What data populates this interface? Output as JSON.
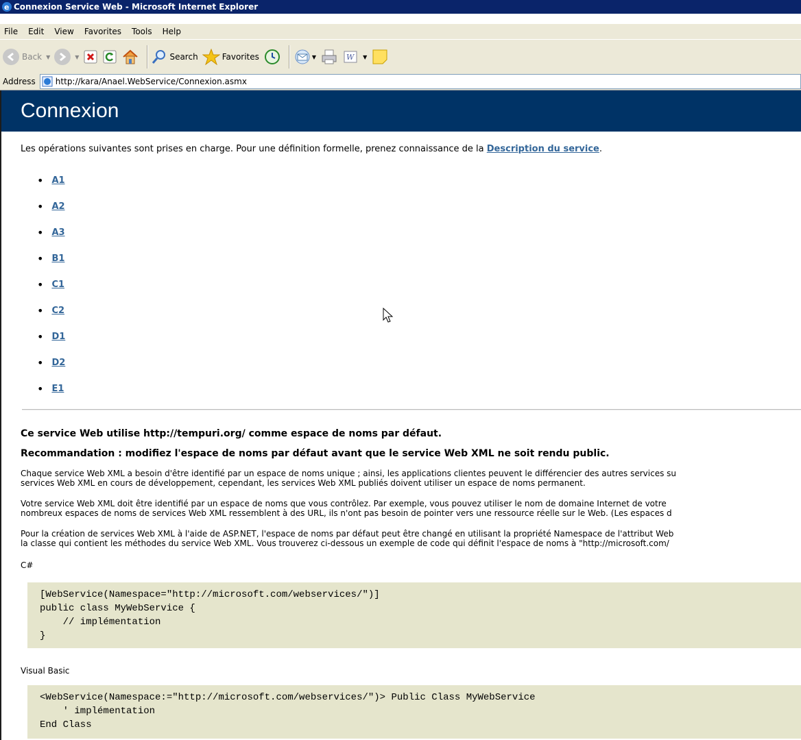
{
  "window": {
    "title": "Connexion Service Web - Microsoft Internet Explorer"
  },
  "menu": [
    "File",
    "Edit",
    "View",
    "Favorites",
    "Tools",
    "Help"
  ],
  "toolbar": {
    "back_label": "Back",
    "search_label": "Search",
    "favorites_label": "Favorites"
  },
  "address": {
    "label": "Address",
    "url": "http://kara/Anael.WebService/Connexion.asmx"
  },
  "page": {
    "heading": "Connexion",
    "intro_text": "Les opérations suivantes sont prises en charge. Pour une définition formelle, prenez connaissance de la ",
    "intro_link": "Description du service",
    "intro_end": ".",
    "operations": [
      "A1",
      "A2",
      "A3",
      "B1",
      "C1",
      "C2",
      "D1",
      "D2",
      "E1"
    ],
    "notice_1": "Ce service Web utilise http://tempuri.org/ comme espace de noms par défaut.",
    "notice_2": "Recommandation : modifiez l'espace de noms par défaut avant que le service Web XML ne soit rendu public.",
    "para_1": [
      "Chaque service Web XML a besoin d'être identifié par un espace de noms unique ; ainsi, les applications clientes peuvent le différencier des autres services su",
      "services Web XML en cours de développement, cependant, les services Web XML publiés doivent utiliser un espace de noms permanent."
    ],
    "para_2": [
      "Votre service Web XML doit être identifié par un espace de noms que vous contrôlez. Par exemple, vous pouvez utiliser le nom de domaine Internet de votre",
      "nombreux espaces de noms de services Web XML ressemblent à des URL, ils n'ont pas besoin de pointer vers une ressource réelle sur le Web. (Les espaces d"
    ],
    "para_3": [
      "Pour la création de services Web XML à l'aide de ASP.NET, l'espace de noms par défaut peut être changé en utilisant la propriété Namespace de l'attribut Web",
      "la classe qui contient les méthodes du service Web XML. Vous trouverez ci-dessous un exemple de code qui définit l'espace de noms à \"http://microsoft.com/"
    ],
    "csharp_label": "C#",
    "csharp_code": "[WebService(Namespace=\"http://microsoft.com/webservices/\")]\npublic class MyWebService {\n    // implémentation\n}",
    "vb_label": "Visual Basic",
    "vb_code": "<WebService(Namespace:=\"http://microsoft.com/webservices/\")> Public Class MyWebService\n    ' implémentation\nEnd Class"
  }
}
